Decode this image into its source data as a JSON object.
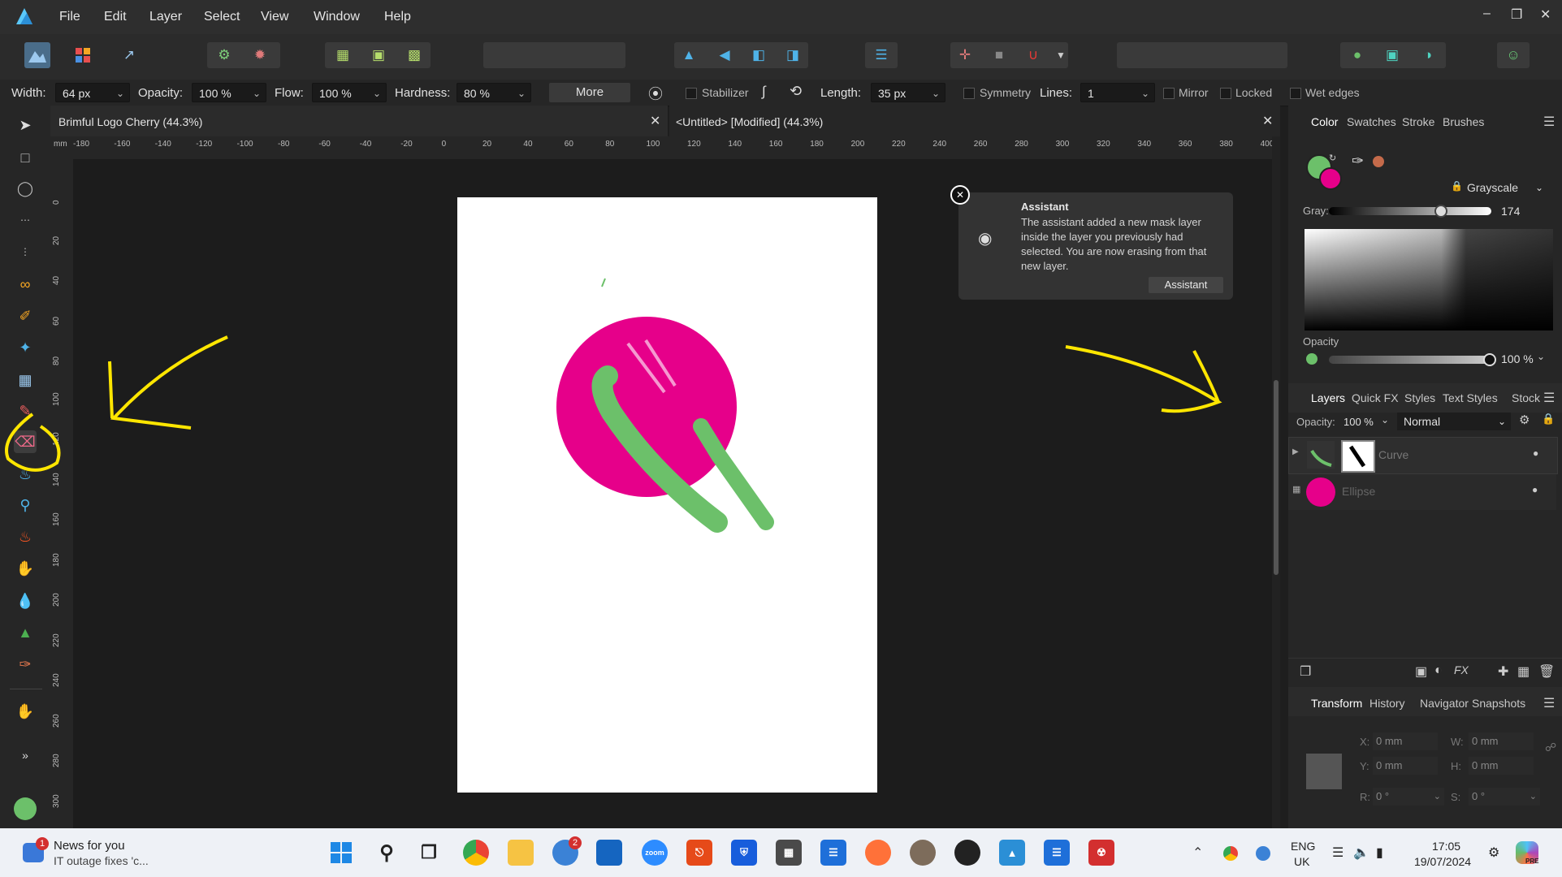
{
  "app": {
    "menu": [
      "File",
      "Edit",
      "Layer",
      "Select",
      "View",
      "Window",
      "Help"
    ]
  },
  "context_bar": {
    "width_label": "Width:",
    "width_value": "64 px",
    "opacity_label": "Opacity:",
    "opacity_value": "100 %",
    "flow_label": "Flow:",
    "flow_value": "100 %",
    "hardness_label": "Hardness:",
    "hardness_value": "80 %",
    "more_label": "More",
    "stabilizer_label": "Stabilizer",
    "length_label": "Length:",
    "length_value": "35 px",
    "symmetry_label": "Symmetry",
    "lines_label": "Lines:",
    "lines_value": "1",
    "mirror_label": "Mirror",
    "locked_label": "Locked",
    "wet_edges_label": "Wet edges"
  },
  "documents": [
    {
      "title": "Brimful Logo Cherry (44.3%)"
    },
    {
      "title": "<Untitled> [Modified] (44.3%)"
    }
  ],
  "ruler": {
    "unit": "mm",
    "h_ticks": [
      "-180",
      "-160",
      "-140",
      "-120",
      "-100",
      "-80",
      "-60",
      "-40",
      "-20",
      "0",
      "20",
      "40",
      "60",
      "80",
      "100",
      "120",
      "140",
      "160",
      "180",
      "200",
      "220",
      "240",
      "260",
      "280",
      "300",
      "320",
      "340",
      "360",
      "380",
      "400"
    ],
    "v_ticks": [
      "0",
      "20",
      "40",
      "60",
      "80",
      "100",
      "120",
      "140",
      "160",
      "180",
      "200",
      "220",
      "240",
      "260",
      "280",
      "300"
    ]
  },
  "assistant": {
    "title": "Assistant",
    "message": "The assistant added a new mask layer inside the layer you previously had selected. You are now erasing from that new layer.",
    "button": "Assistant"
  },
  "color_panel": {
    "tabs": [
      "Color",
      "Swatches",
      "Stroke",
      "Brushes"
    ],
    "mode": "Grayscale",
    "gray_label": "Gray:",
    "gray_value": "174",
    "gray_fraction": 0.68,
    "opacity_label": "Opacity",
    "opacity_value": "100 %",
    "primary_color": "#6cc06a",
    "secondary_color": "#e6008a"
  },
  "layers_panel": {
    "tabs": [
      "Layers",
      "Quick FX",
      "Styles",
      "Text Styles",
      "Stock"
    ],
    "opacity_label": "Opacity:",
    "opacity_value": "100 %",
    "blend_mode": "Normal",
    "layers": [
      {
        "name": "Curve"
      },
      {
        "name": "Ellipse"
      }
    ]
  },
  "transform_panel": {
    "tabs": [
      "Transform",
      "History",
      "Navigator",
      "Snapshots"
    ],
    "x_label": "X:",
    "x_value": "0 mm",
    "y_label": "Y:",
    "y_value": "0 mm",
    "w_label": "W:",
    "w_value": "0 mm",
    "h_label": "H:",
    "h_value": "0 mm",
    "r_label": "R:",
    "r_value": "0 °",
    "s_label": "S:",
    "s_value": "0 °"
  },
  "taskbar": {
    "news_title": "News for you",
    "news_sub": "IT outage fixes 'c...",
    "news_badge": "1",
    "vpn_badge": "2",
    "zoom_label": "zoom",
    "lang_1": "ENG",
    "lang_2": "UK",
    "time": "17:05",
    "date": "19/07/2024",
    "pre_label": "PRE"
  }
}
